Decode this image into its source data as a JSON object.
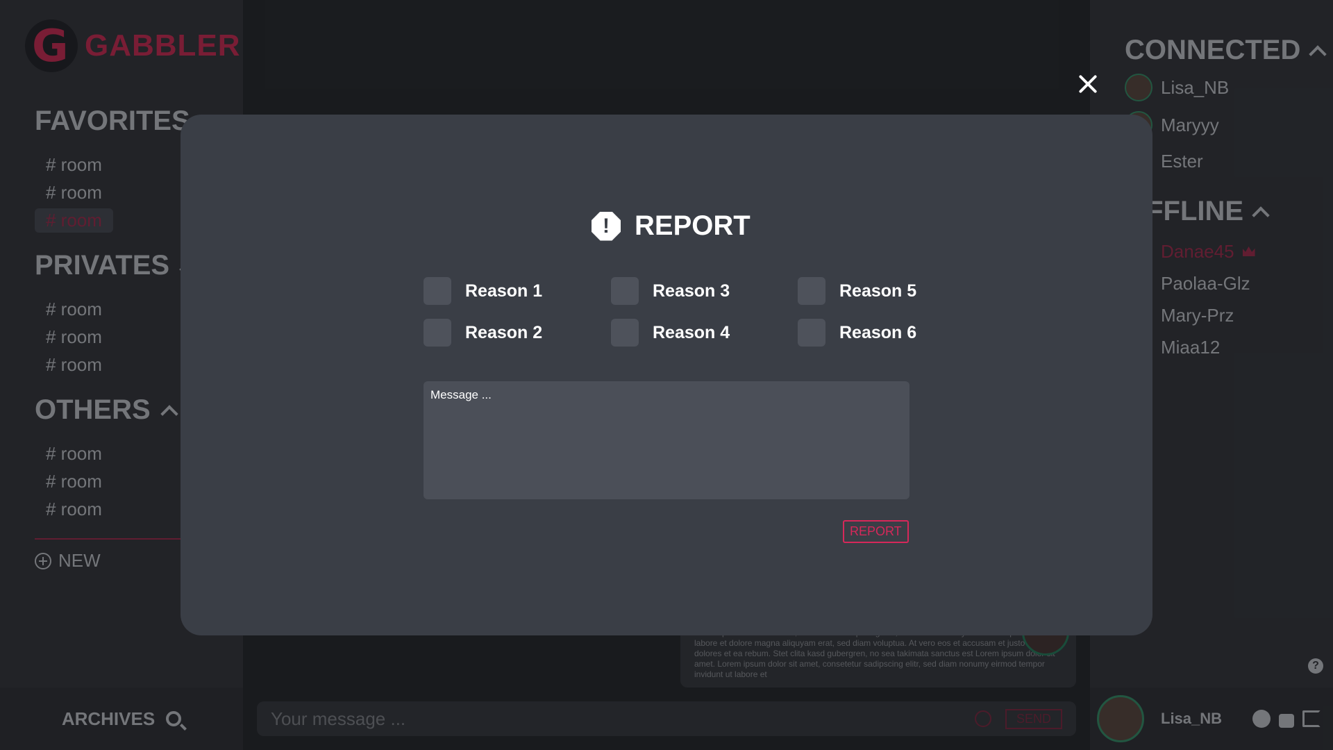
{
  "brand": {
    "name": "GABBLER",
    "letter": "G",
    "color": "#b02245"
  },
  "left": {
    "favorites": {
      "title": "FAVORITES",
      "rooms": [
        "# room",
        "# room",
        "# room"
      ]
    },
    "privates": {
      "title": "PRIVATES",
      "rooms": [
        "# room",
        "# room",
        "# room"
      ]
    },
    "others": {
      "title": "OTHERS",
      "rooms": [
        "# room",
        "# room",
        "# room"
      ]
    },
    "new_label": "NEW",
    "archives_label": "ARCHIVES"
  },
  "chat": {
    "bubble_text": "Lorem ipsum dolor sit amet, consetetur sadipscing elitr, sed diam nonumy eirmod tempor invidunt ut labore et dolore magna aliquyam erat, sed diam voluptua. At vero eos et accusam et justo duo dolores et ea rebum. Stet clita kasd gubergren, no sea takimata sanctus est Lorem ipsum dolor sit amet. Lorem ipsum dolor sit amet, consetetur sadipscing elitr, sed diam nonumy eirmod tempor invidunt ut labore et",
    "input_placeholder": "Your message ...",
    "send_label": "SEND"
  },
  "right": {
    "connected": {
      "title": "CONNECTED",
      "users": [
        "Lisa_NB",
        "Maryyy",
        "Ester"
      ]
    },
    "offline": {
      "title": "OFFLINE",
      "users": [
        "Danae45",
        "Paolaa-Glz",
        "Mary-Prz",
        "Miaa12"
      ]
    },
    "help": "?",
    "profile_name": "Lisa_NB"
  },
  "modal": {
    "title": "REPORT",
    "reasons": [
      "Reason 1",
      "Reason 2",
      "Reason 3",
      "Reason 4",
      "Reason 5",
      "Reason 6"
    ],
    "message_placeholder": "Message ...",
    "submit_label": "REPORT",
    "accent": "#d6285a"
  }
}
